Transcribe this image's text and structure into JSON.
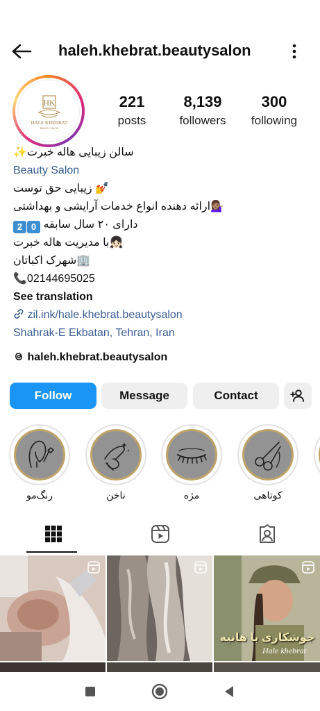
{
  "header": {
    "username": "haleh.khebrat.beautysalon"
  },
  "avatar": {
    "logo_text": "HALE KHEBRAT",
    "logo_sub": "BEAUTY SALON",
    "monogram": "HK"
  },
  "stats": {
    "posts_count": "221",
    "posts_label": "posts",
    "followers_count": "8,139",
    "followers_label": "followers",
    "following_count": "300",
    "following_label": "following"
  },
  "bio": {
    "name_line": "سالن زیبایی هاله خبرت✨",
    "category": "Beauty Salon",
    "line1": "💅 زیبایی حق توست",
    "line2": "💁🏽‍♀️ارائه دهنده انواع خدمات آرایشی و بهداشتی",
    "line3": "دارای ۲۰ سال سابقه",
    "line3_badge": "2️⃣0️⃣",
    "line4": "👧🏻با مدیریت هاله خبرت",
    "line5": "🏢شهرک اکباتان",
    "phone": "📞02144695025",
    "see_translation": "See translation",
    "link": "zil.ink/hale.khebrat.beautysalon",
    "location": "Shahrak-E Ekbatan, Tehran, Iran",
    "threads_handle": "haleh.khebrat.beautysalon"
  },
  "buttons": {
    "follow": "Follow",
    "message": "Message",
    "contact": "Contact"
  },
  "highlights": [
    {
      "label": "رنگ‌مو",
      "icon": "hair-color-icon"
    },
    {
      "label": "ناخن",
      "icon": "nail-icon"
    },
    {
      "label": "مژه",
      "icon": "eyelash-icon"
    },
    {
      "label": "کوتاهی",
      "icon": "scissors-icon"
    }
  ],
  "tabs": [
    {
      "name": "grid-icon"
    },
    {
      "name": "reels-icon"
    },
    {
      "name": "tagged-icon"
    }
  ],
  "grid": {
    "tile3_text": "جوشکاری با هانیه",
    "tile3_sub": "Hale khebrat"
  },
  "colors": {
    "follow_button": "#1b95f5",
    "link_blue": "#375d8c",
    "highlight_gold": "#bfa46a"
  }
}
